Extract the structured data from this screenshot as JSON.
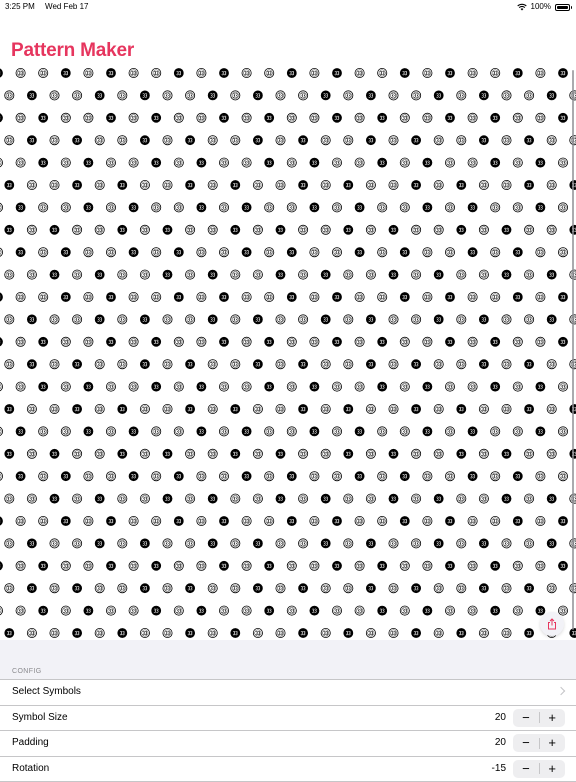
{
  "status_bar": {
    "time": "3:25 PM",
    "date": "Wed Feb 17",
    "battery": "100%",
    "icons": [
      "wifi-icon",
      "battery-icon"
    ]
  },
  "app": {
    "title": "Pattern Maker",
    "accent_color": "#e6355e"
  },
  "pattern": {
    "symbol_style": "circled-number-33",
    "fill_variants": [
      "filled-black",
      "outlined"
    ]
  },
  "share_icon": "share-icon",
  "config": {
    "section_title": "CONFIG",
    "rows": [
      {
        "label": "Select Symbols",
        "value": "",
        "control": "chevron"
      },
      {
        "label": "Symbol Size",
        "value": "20",
        "control": "stepper"
      },
      {
        "label": "Padding",
        "value": "20",
        "control": "stepper"
      },
      {
        "label": "Rotation",
        "value": "-15",
        "control": "stepper"
      }
    ],
    "stepper_minus": "−",
    "stepper_plus": "+"
  }
}
